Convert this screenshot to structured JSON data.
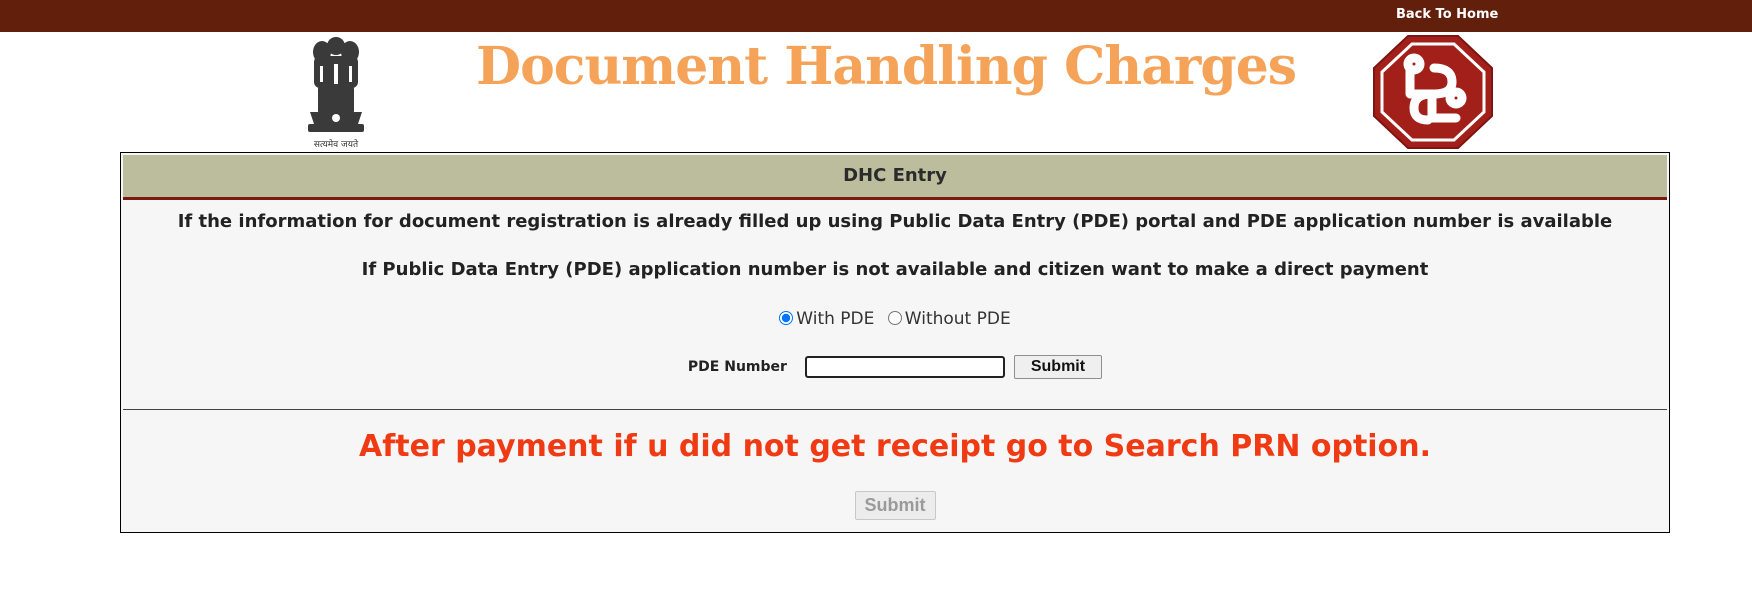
{
  "topbar": {
    "back_home_label": "Back To Home",
    "bar_color": "#621f0c"
  },
  "header": {
    "title": "Document Handling Charges",
    "title_color": "#f6a35a",
    "emblem_caption": "सत्यमेव जयते",
    "left_logo_icon": "national-emblem-icon",
    "right_logo_icon": "department-seal-icon"
  },
  "panel": {
    "heading": "DHC Entry",
    "info_line_1": "If the information for document registration is already filled up using Public Data Entry (PDE) portal and PDE application number is available",
    "info_line_2": "If Public Data Entry (PDE) application number is not available and citizen want to make a direct payment",
    "radio_options": [
      {
        "label": "With PDE",
        "checked": true
      },
      {
        "label": "Without PDE",
        "checked": false
      }
    ],
    "pde_number_label": "PDE Number",
    "pde_number_value": "",
    "submit_label": "Submit",
    "notice": "After payment if u did not get receipt go to Search PRN option.",
    "notice_color": "#f03a14",
    "bottom_submit_label": "Submit",
    "bottom_submit_disabled": true
  }
}
